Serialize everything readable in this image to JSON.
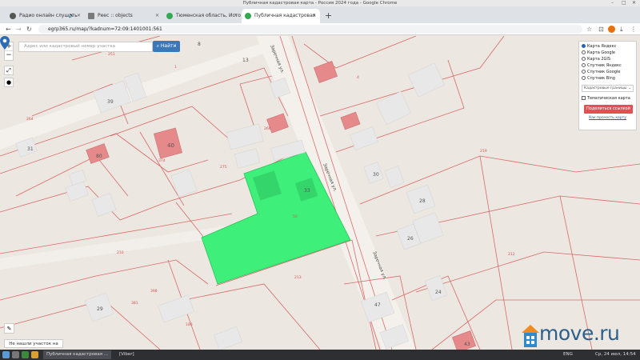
{
  "window": {
    "title": "Публичная кадастровая карта - Россия 2024 года - Google Chrome",
    "controls": [
      "–",
      "□",
      "✕"
    ]
  },
  "tabs": [
    {
      "label": "Радио онлайн слушать",
      "icon": "radio-favicon",
      "color": "#555555",
      "speaker": "🔈",
      "active": false
    },
    {
      "label": "Реес :: objects",
      "icon": "document-favicon",
      "color": "#6a6a6a",
      "active": false
    },
    {
      "label": "Тюменская область, Исто",
      "icon": "check-favicon",
      "color": "#34a853",
      "active": false
    },
    {
      "label": "Публичная кадастровая",
      "icon": "check-favicon",
      "color": "#34a853",
      "active": true
    }
  ],
  "toolbar": {
    "url": "egrp365.ru/map/?kadnum=72:09:1401001:561",
    "back": "←",
    "forward": "→",
    "reload": "↻",
    "new_tab": "+"
  },
  "map": {
    "search_placeholder": "Адрес или кадастровый номер участка",
    "find_button": "Найти",
    "zoom_in": "+",
    "zoom_out": "−",
    "not_found_link": "Не нашли участок на карте?",
    "layer_options": [
      {
        "label": "Карта Яндекс",
        "selected": true
      },
      {
        "label": "Карта Google",
        "selected": false
      },
      {
        "label": "Карта 2GIS",
        "selected": false
      },
      {
        "label": "Спутник Яндекс",
        "selected": false
      },
      {
        "label": "Спутник Google",
        "selected": false
      },
      {
        "label": "Спутник Bing",
        "selected": false
      }
    ],
    "layer_select": "Кадастровые границы",
    "thematic_checkbox": "Тематическая карта",
    "share_button": "Поделиться ссылкой",
    "hint_link": "Как прочесть карту",
    "street_label": "Заречная ул.",
    "house_numbers": [
      "39",
      "40",
      "80",
      "30",
      "33",
      "28",
      "26",
      "24",
      "29",
      "47",
      "43",
      "31",
      "13",
      "8"
    ],
    "parcel_numbers": [
      "251",
      "264",
      "374",
      "266",
      "275",
      "210",
      "398",
      "381",
      "213",
      "212",
      "219",
      "1",
      "4",
      "186",
      "50"
    ],
    "highlight_color": "#3ef07a",
    "building_color": "#e8e8e8",
    "red_building_color": "#e6898b",
    "watermark": "move.ru"
  },
  "taskbar": {
    "items": [
      "Публичная кадастровая ...",
      "[Viber]"
    ],
    "clock": "Ср, 24 июл, 14:54",
    "lang": "ENG"
  }
}
